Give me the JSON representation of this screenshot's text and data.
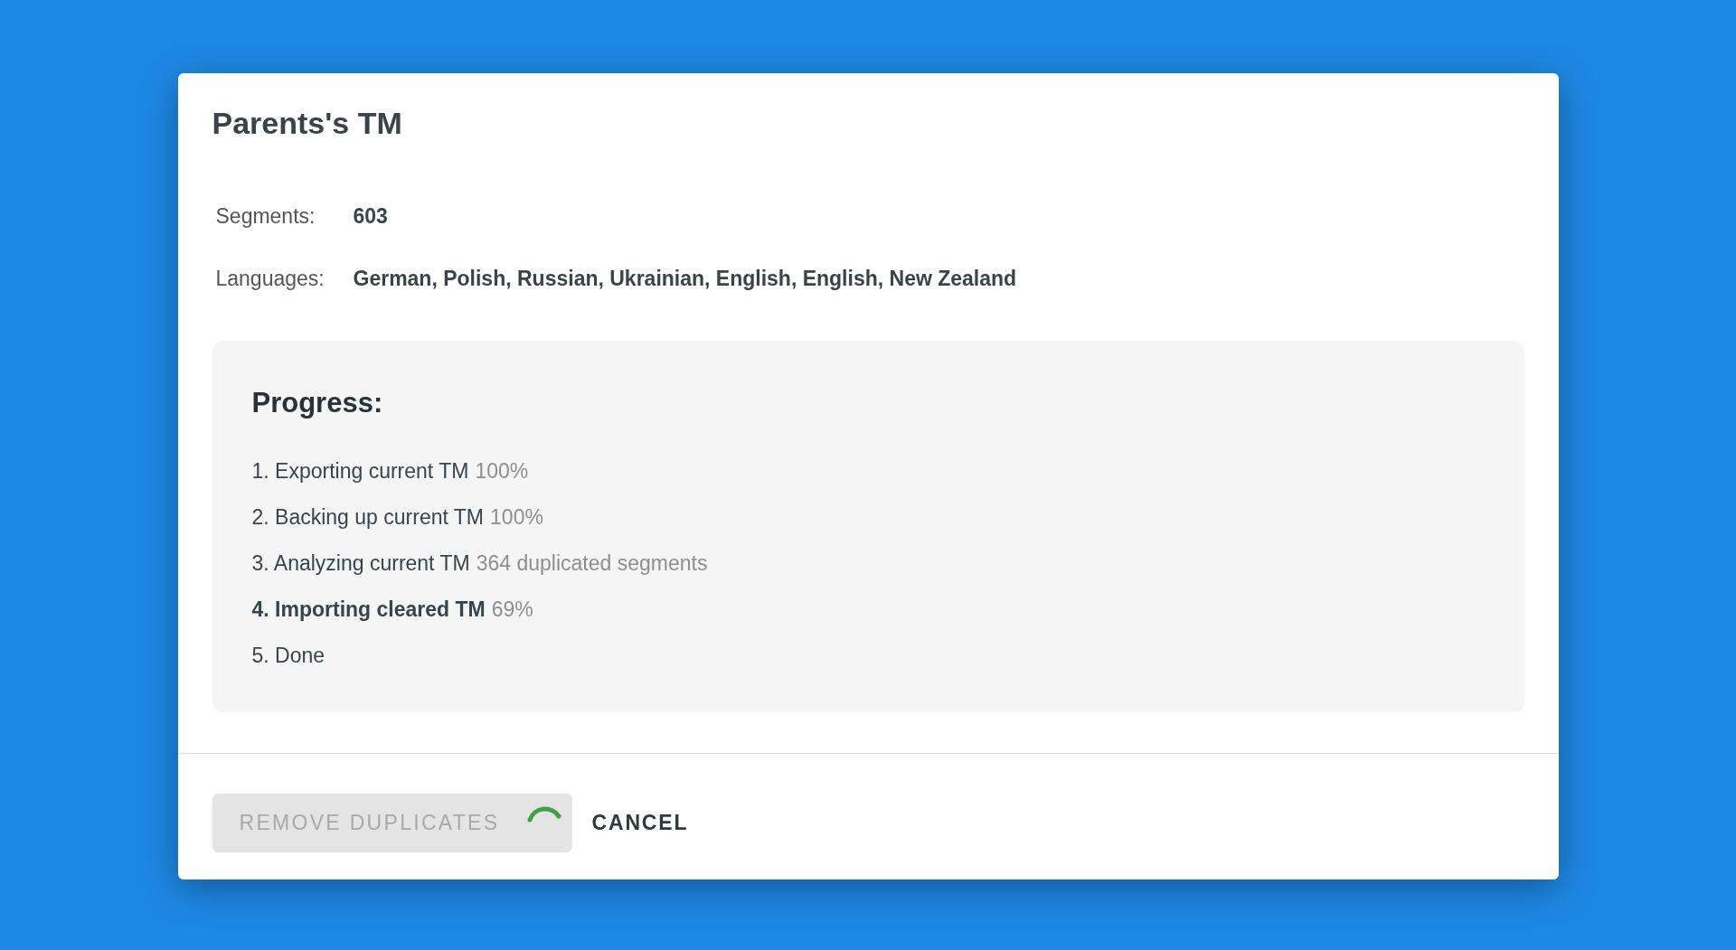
{
  "dialog": {
    "title": "Parents's TM",
    "info": [
      {
        "label": "Segments:",
        "value": "603"
      },
      {
        "label": "Languages:",
        "value": "German, Polish, Russian, Ukrainian, English, English, New Zealand"
      }
    ],
    "progress": {
      "title": "Progress:",
      "steps": [
        {
          "number": "1.",
          "label": "Exporting current TM",
          "detail": "100%",
          "active": false
        },
        {
          "number": "2.",
          "label": "Backing up current TM",
          "detail": "100%",
          "active": false
        },
        {
          "number": "3.",
          "label": "Analyzing current TM",
          "detail": "364 duplicated segments",
          "active": false
        },
        {
          "number": "4.",
          "label": "Importing cleared TM",
          "detail": "69%",
          "active": true
        },
        {
          "number": "5.",
          "label": "Done",
          "active": false
        }
      ]
    },
    "actions": [
      {
        "label": "REMOVE DUPLICATES",
        "kind": "primary",
        "disabled": true,
        "loading": true
      },
      {
        "label": "CANCEL",
        "kind": "text",
        "disabled": false
      }
    ]
  }
}
